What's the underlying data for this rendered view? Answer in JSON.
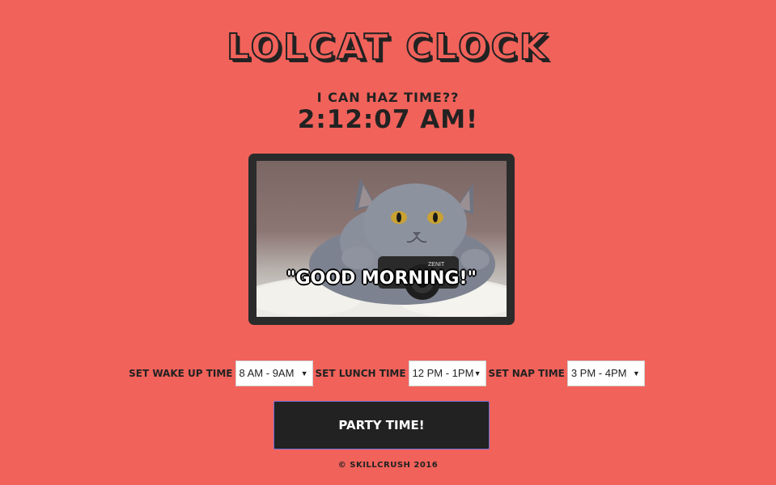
{
  "app": {
    "title": "LOLCAT CLOCK"
  },
  "header": {
    "subtitle": "I CAN HAZ TIME??",
    "clock_time": "2:12:07 AM!"
  },
  "lolcat_image": {
    "caption": "\"GOOD MORNING!\"",
    "camera_brand": "ZENIT"
  },
  "controls": {
    "wake_up": {
      "label": "SET WAKE UP TIME",
      "selected": "8 AM - 9AM"
    },
    "lunch": {
      "label": "SET LUNCH TIME",
      "selected": "12 PM - 1PM"
    },
    "nap": {
      "label": "SET NAP TIME",
      "selected": "3 PM - 4PM"
    }
  },
  "party_button": {
    "label": "PARTY TIME!"
  },
  "footer": {
    "copyright": "© SKILLCRUSH 2016"
  },
  "colors": {
    "background": "#f1625a",
    "text": "#222222",
    "button_bg": "#222222",
    "button_text": "#ffffff",
    "button_border": "#6d6fd6"
  }
}
